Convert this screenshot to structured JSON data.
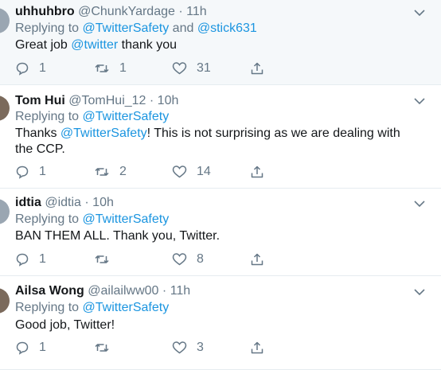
{
  "tweets": [
    {
      "name": "uhhuhbro",
      "handle": "@ChunkYardage",
      "sep": "·",
      "time": "11h",
      "replying_prefix": "Replying to",
      "reply_targets": [
        "@TwitterSafety",
        "and",
        "@stick631"
      ],
      "text_parts": [
        "Great job ",
        "@twitter",
        " thank you"
      ],
      "replies": "1",
      "retweets": "1",
      "likes": "31"
    },
    {
      "name": "Tom Hui",
      "handle": "@TomHui_12",
      "sep": "·",
      "time": "10h",
      "replying_prefix": "Replying to",
      "reply_targets": [
        "@TwitterSafety"
      ],
      "text_parts": [
        "Thanks ",
        "@TwitterSafety",
        "! This is not surprising as we are dealing with",
        "the CCP."
      ],
      "replies": "1",
      "retweets": "2",
      "likes": "14"
    },
    {
      "name": "idtia",
      "handle": "@idtia",
      "sep": "·",
      "time": "10h",
      "replying_prefix": "Replying to",
      "reply_targets": [
        "@TwitterSafety"
      ],
      "text_parts": [
        "BAN THEM ALL. Thank you, Twitter."
      ],
      "replies": "1",
      "retweets": "",
      "likes": "8"
    },
    {
      "name": "Ailsa Wong",
      "handle": "@ailailww00",
      "sep": "·",
      "time": "11h",
      "replying_prefix": "Replying to",
      "reply_targets": [
        "@TwitterSafety"
      ],
      "text_parts": [
        "Good job, Twitter!"
      ],
      "replies": "1",
      "retweets": "",
      "likes": "3"
    }
  ],
  "colors": {
    "link": "#1b95e0",
    "secondary": "#657786",
    "primary": "#14171a",
    "shaded_bg": "#f5f8fa",
    "divider": "#e6ecf0"
  },
  "icons": {
    "reply": "reply-icon",
    "retweet": "retweet-icon",
    "like": "heart-icon",
    "share": "share-icon",
    "menu": "chevron-down-icon"
  }
}
